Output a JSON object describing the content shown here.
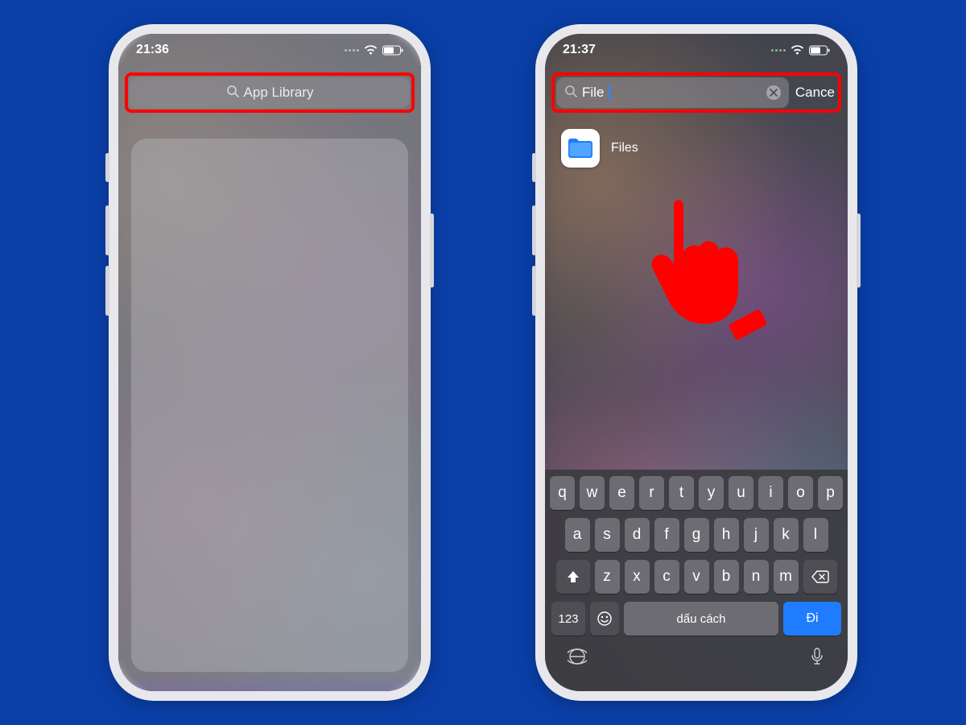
{
  "left": {
    "time": "21:36",
    "search_placeholder": "App Library"
  },
  "right": {
    "time": "21:37",
    "search_value": "File",
    "cancel": "Cance",
    "result_app": "Files",
    "keyboard": {
      "row1": [
        "q",
        "w",
        "e",
        "r",
        "t",
        "y",
        "u",
        "i",
        "o",
        "p"
      ],
      "row2": [
        "a",
        "s",
        "d",
        "f",
        "g",
        "h",
        "j",
        "k",
        "l"
      ],
      "row3": [
        "z",
        "x",
        "c",
        "v",
        "b",
        "n",
        "m"
      ],
      "numbers": "123",
      "space": "dấu cách",
      "go": "Đi"
    }
  }
}
